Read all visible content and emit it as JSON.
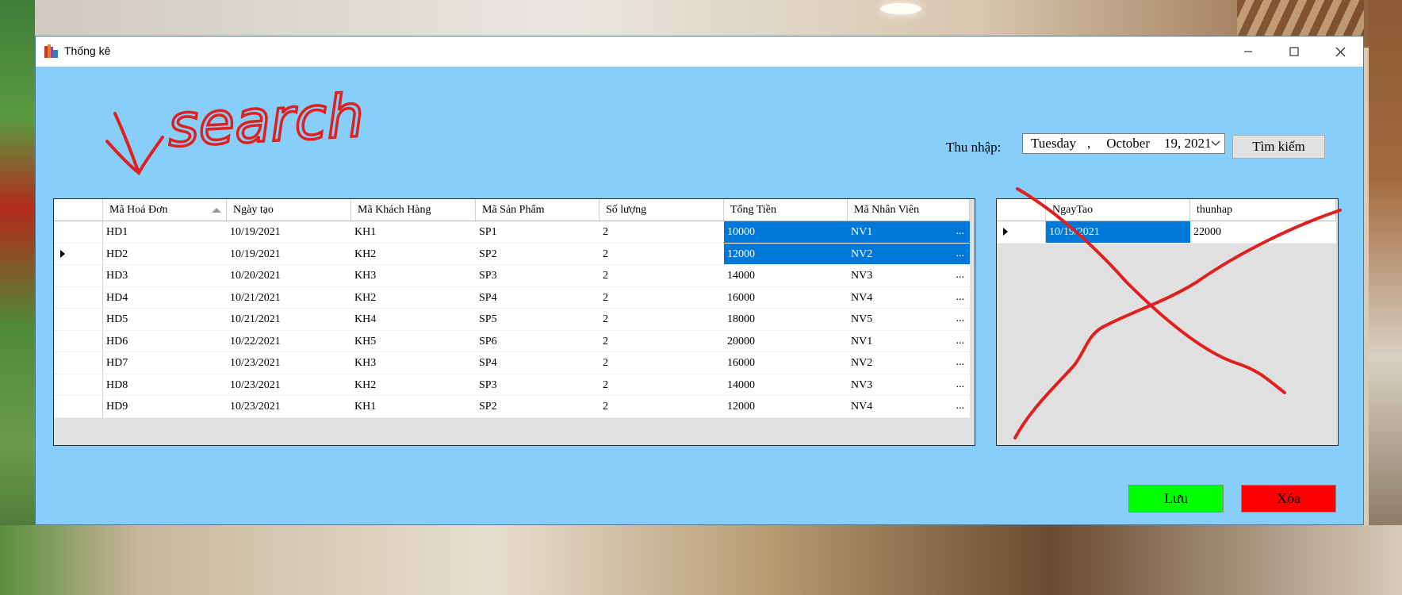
{
  "window": {
    "title": "Thống kê"
  },
  "search": {
    "label": "Thu nhập:",
    "date_day": "Tuesday",
    "date_comma": ",",
    "date_month": "October",
    "date_rest": "19, 2021",
    "button": "Tìm kiếm"
  },
  "main_grid": {
    "columns": [
      "Mã Hoá Đơn",
      "Ngày tạo",
      "Mã Khách Hàng",
      "Mã Sản Phẩm",
      "Số lượng",
      "Tổng Tiền",
      "Mã Nhân Viên"
    ],
    "rows": [
      [
        "HD1",
        "10/19/2021",
        "KH1",
        "SP1",
        "2",
        "10000",
        "NV1"
      ],
      [
        "HD2",
        "10/19/2021",
        "KH2",
        "SP2",
        "2",
        "12000",
        "NV2"
      ],
      [
        "HD3",
        "10/20/2021",
        "KH3",
        "SP3",
        "2",
        "14000",
        "NV3"
      ],
      [
        "HD4",
        "10/21/2021",
        "KH2",
        "SP4",
        "2",
        "16000",
        "NV4"
      ],
      [
        "HD5",
        "10/21/2021",
        "KH4",
        "SP5",
        "2",
        "18000",
        "NV5"
      ],
      [
        "HD6",
        "10/22/2021",
        "KH5",
        "SP6",
        "2",
        "20000",
        "NV1"
      ],
      [
        "HD7",
        "10/23/2021",
        "KH3",
        "SP4",
        "2",
        "16000",
        "NV2"
      ],
      [
        "HD8",
        "10/23/2021",
        "KH2",
        "SP3",
        "2",
        "14000",
        "NV3"
      ],
      [
        "HD9",
        "10/23/2021",
        "KH1",
        "SP2",
        "2",
        "12000",
        "NV4"
      ]
    ],
    "ellipsis": "...",
    "selected_rows": [
      0,
      1
    ],
    "selected_from_col": 5,
    "current_row": 1
  },
  "income_grid": {
    "columns": [
      "NgayTao",
      "thunhap"
    ],
    "rows": [
      [
        "10/19/2021",
        "22000"
      ]
    ]
  },
  "buttons": {
    "save": "Lưu",
    "delete": "Xóa"
  },
  "annotation": {
    "handwritten_text": "search"
  },
  "colors": {
    "window_bg": "#87cefa",
    "selection": "#0078d7",
    "save_button": "#00ff00",
    "delete_button": "#ff0000",
    "ink": "#e0201e"
  }
}
